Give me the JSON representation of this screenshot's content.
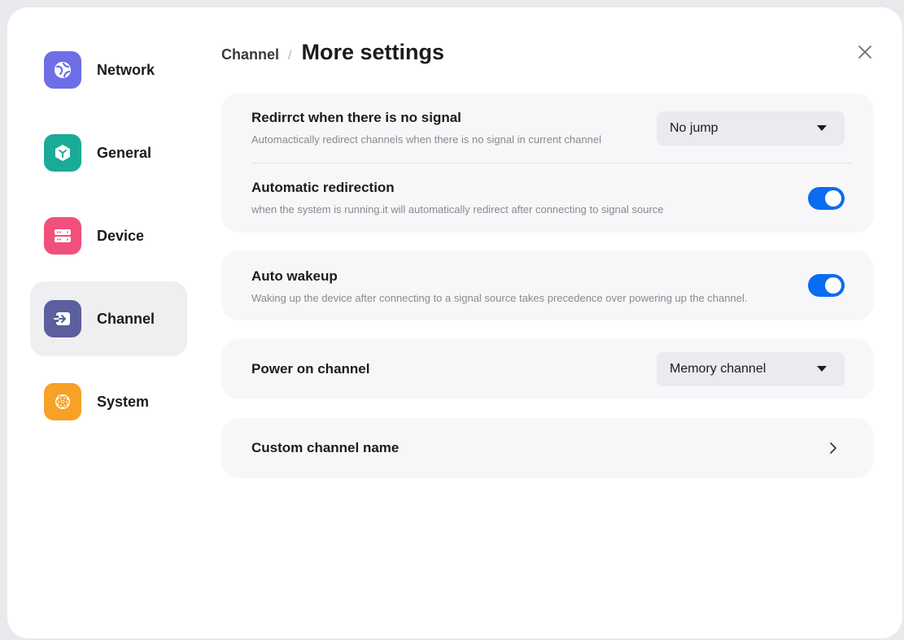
{
  "sidebar": {
    "items": [
      {
        "label": "Network",
        "color": "#6e6ee6",
        "icon": "globe-icon"
      },
      {
        "label": "General",
        "color": "#1aab96",
        "icon": "cube-icon"
      },
      {
        "label": "Device",
        "color": "#f0507a",
        "icon": "server-icon"
      },
      {
        "label": "Channel",
        "color": "#5c5f9e",
        "icon": "input-icon",
        "active": true
      },
      {
        "label": "System",
        "color": "#f7a126",
        "icon": "atom-icon"
      }
    ]
  },
  "header": {
    "breadcrumb_parent": "Channel",
    "separator": "/",
    "title": "More settings"
  },
  "settings": {
    "redirect_no_signal": {
      "title": "Redirrct when there is no signal",
      "desc": "Automactically redirect channels when there is no signal in current channel",
      "value": "No jump"
    },
    "auto_redirection": {
      "title": "Automatic redirection",
      "desc": "when the system is running.it will automatically redirect after connecting to signal source",
      "enabled": true
    },
    "auto_wakeup": {
      "title": "Auto wakeup",
      "desc": "Waking up the device after connecting to a signal source takes precedence over powering up the channel.",
      "enabled": true
    },
    "power_on_channel": {
      "title": "Power on channel",
      "value": "Memory channel"
    },
    "custom_channel_name": {
      "title": "Custom channel name"
    }
  },
  "colors": {
    "accent": "#0a6cf0",
    "card_bg": "#f7f7f9",
    "active_bg": "#efeff2"
  }
}
